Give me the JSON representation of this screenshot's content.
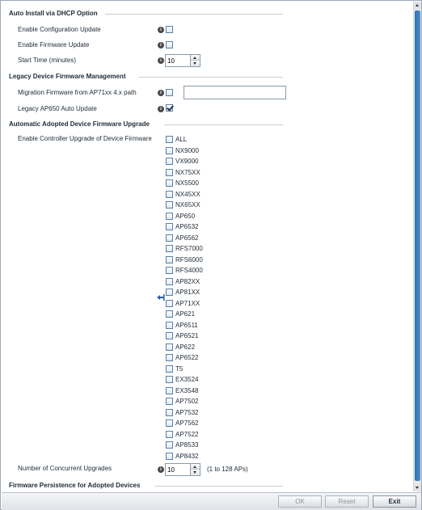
{
  "sections": {
    "auto_install": "Auto Install via DHCP Option",
    "legacy_mgmt": "Legacy Device Firmware Management",
    "auto_upgrade": "Automatic Adopted Device Firmware Upgrade",
    "persistence": "Firmware Persistence for Adopted Devices"
  },
  "auto_install": {
    "config_update_label": "Enable Configuration Update",
    "config_update_checked": false,
    "firmware_update_label": "Enable Firmware Update",
    "firmware_update_checked": false,
    "start_time_label": "Start Time (minutes)",
    "start_time_value": "10"
  },
  "legacy": {
    "migration_label": "Migration Firmware from AP71xx 4.x path",
    "migration_checked": false,
    "migration_path_value": "",
    "ap650_label": "Legacy AP650 Auto Update",
    "ap650_checked": true
  },
  "auto_upgrade": {
    "enable_label": "Enable Controller Upgrade of Device Firmware",
    "devices": [
      "ALL",
      "NX9000",
      "VX9000",
      "NX75XX",
      "NX5500",
      "NX45XX",
      "NX65XX",
      "AP650",
      "AP6532",
      "AP6562",
      "RFS7000",
      "RFS6000",
      "RFS4000",
      "AP82XX",
      "AP81XX",
      "AP71XX",
      "AP621",
      "AP6511",
      "AP6521",
      "AP622",
      "AP6522",
      "T5",
      "EX3524",
      "EX3548",
      "AP7502",
      "AP7532",
      "AP7562",
      "AP7522",
      "AP8533",
      "AP8432"
    ],
    "concurrent_label": "Number of Concurrent Upgrades",
    "concurrent_value": "10",
    "concurrent_range": "(1 to 128 APs)"
  },
  "icons": {
    "info": "info-icon",
    "scroll": "scrollbar"
  },
  "footer": {
    "ok": "OK",
    "reset": "Reset",
    "exit": "Exit"
  },
  "colors": {
    "accent": "#2f6fb0",
    "checkbox_border": "#5b7fa6",
    "text": "#1f2a36"
  }
}
